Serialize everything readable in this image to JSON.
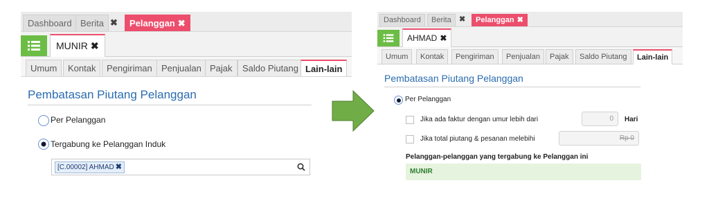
{
  "colors": {
    "accent_pink": "#ec4e6c",
    "menu_green": "#6cbd45",
    "title_blue": "#2b6cb0",
    "arrow_green": "#70ad47"
  },
  "before": {
    "top_tabs": [
      "Dashboard",
      "Berita",
      "Pelanggan"
    ],
    "close_symbol": "✖",
    "record_tab": "MUNIR",
    "sub_tabs": [
      "Umum",
      "Kontak",
      "Pengiriman",
      "Penjualan",
      "Pajak",
      "Saldo Piutang",
      "Lain-lain"
    ],
    "section_title": "Pembatasan Piutang Pelanggan",
    "options": [
      "Per Pelanggan",
      "Tergabung ke Pelanggan Induk"
    ],
    "selected_option": "Tergabung ke Pelanggan Induk",
    "parent_tag": "[C.00002] AHMAD",
    "icons": [
      "menu-icon",
      "search-icon"
    ]
  },
  "after": {
    "top_tabs": [
      "Dashboard",
      "Berita",
      "Pelanggan"
    ],
    "record_tab": "AHMAD",
    "sub_tabs": [
      "Umum",
      "Kontak",
      "Pengiriman",
      "Penjualan",
      "Pajak",
      "Saldo Piutang",
      "Lain-lain"
    ],
    "section_title": "Pembatasan Piutang Pelanggan",
    "option": "Per Pelanggan",
    "check1_label": "Jika ada faktur dengan umur lebih dari",
    "check1_value": "0",
    "check1_unit": "Hari",
    "check2_label": "Jika total piutang & pesanan melebihi",
    "check2_value": "Rp 0",
    "linked_heading": "Pelanggan-pelanggan yang tergabung ke Pelanggan ini",
    "linked_customers": [
      "MUNIR"
    ]
  }
}
